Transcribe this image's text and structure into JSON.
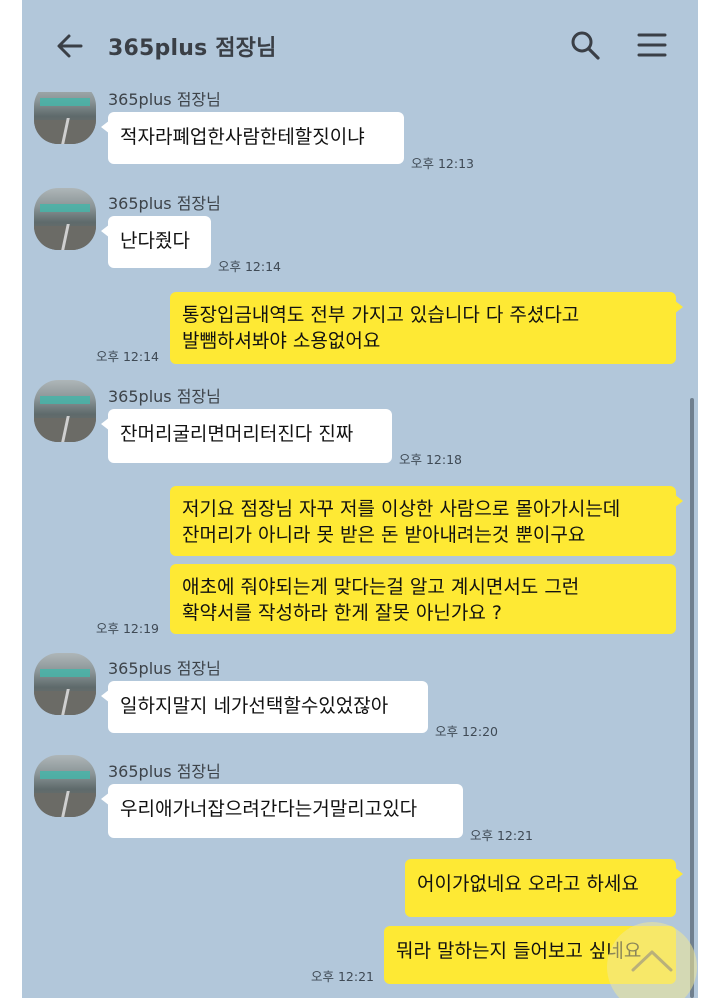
{
  "header": {
    "title": "365plus 점장님",
    "back_icon": "arrow-left-icon",
    "search_icon": "search-icon",
    "menu_icon": "hamburger-menu-icon"
  },
  "colors": {
    "background": "#b2c7da",
    "incoming_bubble": "#ffffff",
    "outgoing_bubble": "#fee934"
  },
  "messages": [
    {
      "direction": "in",
      "sender": "365plus 점장님",
      "lines": [
        "적자라폐업한사람한테할짓이냐"
      ],
      "time": "오후 12:13"
    },
    {
      "direction": "in",
      "sender": "365plus 점장님",
      "lines": [
        "난다줬다"
      ],
      "time": "오후 12:14"
    },
    {
      "direction": "out",
      "lines": [
        "통장입금내역도 전부 가지고 있습니다 다 주셨다고",
        "발뺌하셔봐야 소용없어요"
      ],
      "time": "오후 12:14"
    },
    {
      "direction": "in",
      "sender": "365plus 점장님",
      "lines": [
        "잔머리굴리면머리터진다 진짜"
      ],
      "time": "오후 12:18"
    },
    {
      "direction": "out",
      "lines": [
        "저기요 점장님 자꾸 저를 이상한 사람으로 몰아가시는데",
        "잔머리가 아니라 못 받은 돈 받아내려는것 뿐이구요"
      ]
    },
    {
      "direction": "out",
      "lines": [
        "애초에 줘야되는게 맞다는걸 알고 계시면서도 그런",
        "확약서를 작성하라 한게 잘못 아닌가요 ?"
      ],
      "time": "오후 12:19"
    },
    {
      "direction": "in",
      "sender": "365plus 점장님",
      "lines": [
        "일하지말지 네가선택할수있었잖아"
      ],
      "time": "오후 12:20"
    },
    {
      "direction": "in",
      "sender": "365plus 점장님",
      "lines": [
        "우리애가너잡으려간다는거말리고있다"
      ],
      "time": "오후 12:21"
    },
    {
      "direction": "out",
      "lines": [
        "어이가없네요 오라고 하세요"
      ]
    },
    {
      "direction": "out",
      "lines": [
        "뭐라 말하는지 들어보고 싶네요"
      ],
      "time": "오후 12:21"
    }
  ]
}
